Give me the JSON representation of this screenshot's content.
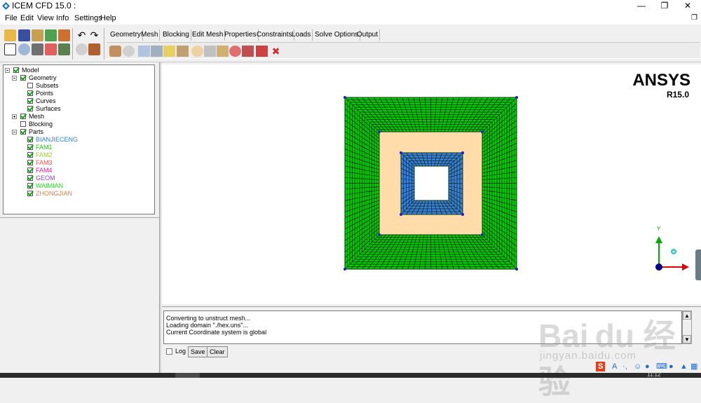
{
  "window": {
    "title": "ICEM CFD 15.0 :",
    "controls": {
      "minimize": "—",
      "restore": "❐",
      "close": "✕",
      "mdi_restore": "❐"
    }
  },
  "menu": [
    "File",
    "Edit",
    "View",
    "Info",
    "Settings",
    "Help"
  ],
  "tabs": [
    {
      "label": "Geometry",
      "active": false
    },
    {
      "label": "Mesh",
      "active": false
    },
    {
      "label": "Blocking",
      "active": true
    },
    {
      "label": "Edit Mesh",
      "active": false
    },
    {
      "label": "Properties",
      "active": false
    },
    {
      "label": "Constraints",
      "active": false
    },
    {
      "label": "Loads",
      "active": false
    },
    {
      "label": "Solve Options",
      "active": false
    },
    {
      "label": "Output",
      "active": false
    }
  ],
  "tree": {
    "items": [
      {
        "label": "Model",
        "color": "#000000",
        "checked": true,
        "expand": "minus",
        "level": 0
      },
      {
        "label": "Geometry",
        "color": "#000000",
        "checked": true,
        "expand": "minus",
        "level": 1
      },
      {
        "label": "Subsets",
        "color": "#000000",
        "checked": false,
        "expand": "",
        "level": 2
      },
      {
        "label": "Points",
        "color": "#000000",
        "checked": true,
        "expand": "",
        "level": 2
      },
      {
        "label": "Curves",
        "color": "#000000",
        "checked": true,
        "expand": "",
        "level": 2
      },
      {
        "label": "Surfaces",
        "color": "#000000",
        "checked": true,
        "expand": "",
        "level": 2
      },
      {
        "label": "Mesh",
        "color": "#000000",
        "checked": true,
        "expand": "plus",
        "level": 1
      },
      {
        "label": "Blocking",
        "color": "#000000",
        "checked": false,
        "expand": "",
        "level": 1
      },
      {
        "label": "Parts",
        "color": "#000000",
        "checked": true,
        "expand": "minus",
        "level": 1
      },
      {
        "label": "BIANJIECENG",
        "color": "#3a7fd0",
        "checked": true,
        "expand": "",
        "level": 2
      },
      {
        "label": "FAM1",
        "color": "#22c022",
        "checked": true,
        "expand": "",
        "level": 2
      },
      {
        "label": "FAM2",
        "color": "#9acd32",
        "checked": true,
        "expand": "",
        "level": 2
      },
      {
        "label": "FAM3",
        "color": "#ff5050",
        "checked": true,
        "expand": "",
        "level": 2
      },
      {
        "label": "FAM4",
        "color": "#e0208a",
        "checked": true,
        "expand": "",
        "level": 2
      },
      {
        "label": "GEOM",
        "color": "#9040d0",
        "checked": true,
        "expand": "",
        "level": 2
      },
      {
        "label": "WAIMIAN",
        "color": "#30d030",
        "checked": true,
        "expand": "",
        "level": 2
      },
      {
        "label": "ZHONGJIAN",
        "color": "#e08040",
        "checked": true,
        "expand": "",
        "level": 2
      }
    ]
  },
  "viewport": {
    "logo": "ANSYS",
    "version": "R15.0",
    "axis_label": "Y",
    "colors": {
      "outer_mesh": "#00cc00",
      "middle_region": "#ffdcaa",
      "inner_mesh": "#3a7fe0",
      "grid_line": "#0a2a0a",
      "axis_y": "#00aa00",
      "axis_x": "#dd0000",
      "axis_z": "#00008b"
    }
  },
  "messages": {
    "lines": [
      "Converting to unstruct mesh...",
      "Loading domain \"./hex.uns\"...",
      "Current Coordinate system is global"
    ],
    "log_label": "Log",
    "save_label": "Save",
    "clear_label": "Clear"
  },
  "watermark": {
    "main": "Bai du 经验",
    "sub": "jingyan.baidu.com"
  },
  "tray": {
    "ime": "S",
    "lang": "A",
    "time": "11:12"
  }
}
